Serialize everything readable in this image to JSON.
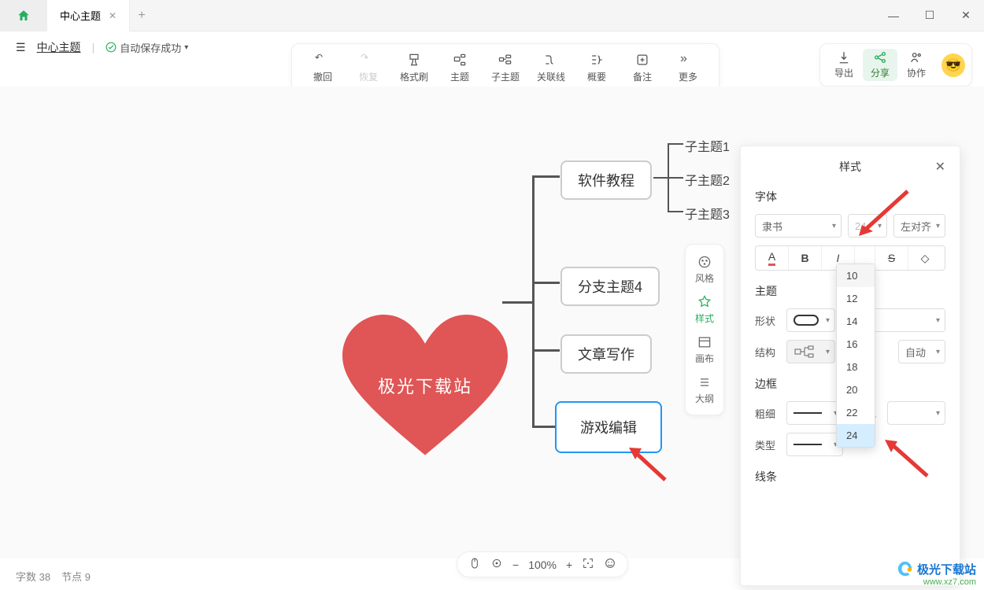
{
  "title_bar": {
    "doc_tab": "中心主题"
  },
  "doc_bar": {
    "title": "中心主题",
    "save_status": "自动保存成功"
  },
  "toolbar": {
    "undo": "撤回",
    "redo": "恢复",
    "format": "格式刷",
    "topic": "主题",
    "subtopic": "子主题",
    "relation": "关联线",
    "summary": "概要",
    "note": "备注",
    "more": "更多"
  },
  "actions": {
    "export": "导出",
    "share": "分享",
    "collab": "协作"
  },
  "mindmap": {
    "center": "极光下载站",
    "branches": [
      "软件教程",
      "分支主题4",
      "文章写作",
      "游戏编辑"
    ],
    "subs": [
      "子主题1",
      "子主题2",
      "子主题3"
    ]
  },
  "side": {
    "style_group": "风格",
    "style": "样式",
    "canvas": "画布",
    "outline": "大纲"
  },
  "panel": {
    "title": "样式",
    "font_section": "字体",
    "font_family": "隶书",
    "font_size": "24",
    "align": "左对齐",
    "theme_section": "主题",
    "shape": "形状",
    "structure": "结构",
    "auto": "自动",
    "border_section": "边框",
    "weight": "粗细",
    "color": "颜色",
    "type": "类型",
    "line_section": "线条"
  },
  "dropdown": {
    "items": [
      "10",
      "12",
      "14",
      "16",
      "18",
      "20",
      "22",
      "24"
    ],
    "hover": "10",
    "selected": "24"
  },
  "status": {
    "words_label": "字数",
    "words": "38",
    "nodes_label": "节点",
    "nodes": "9",
    "zoom": "100%"
  },
  "watermark": {
    "brand": "极光下载站",
    "url": "www.xz7.com"
  }
}
